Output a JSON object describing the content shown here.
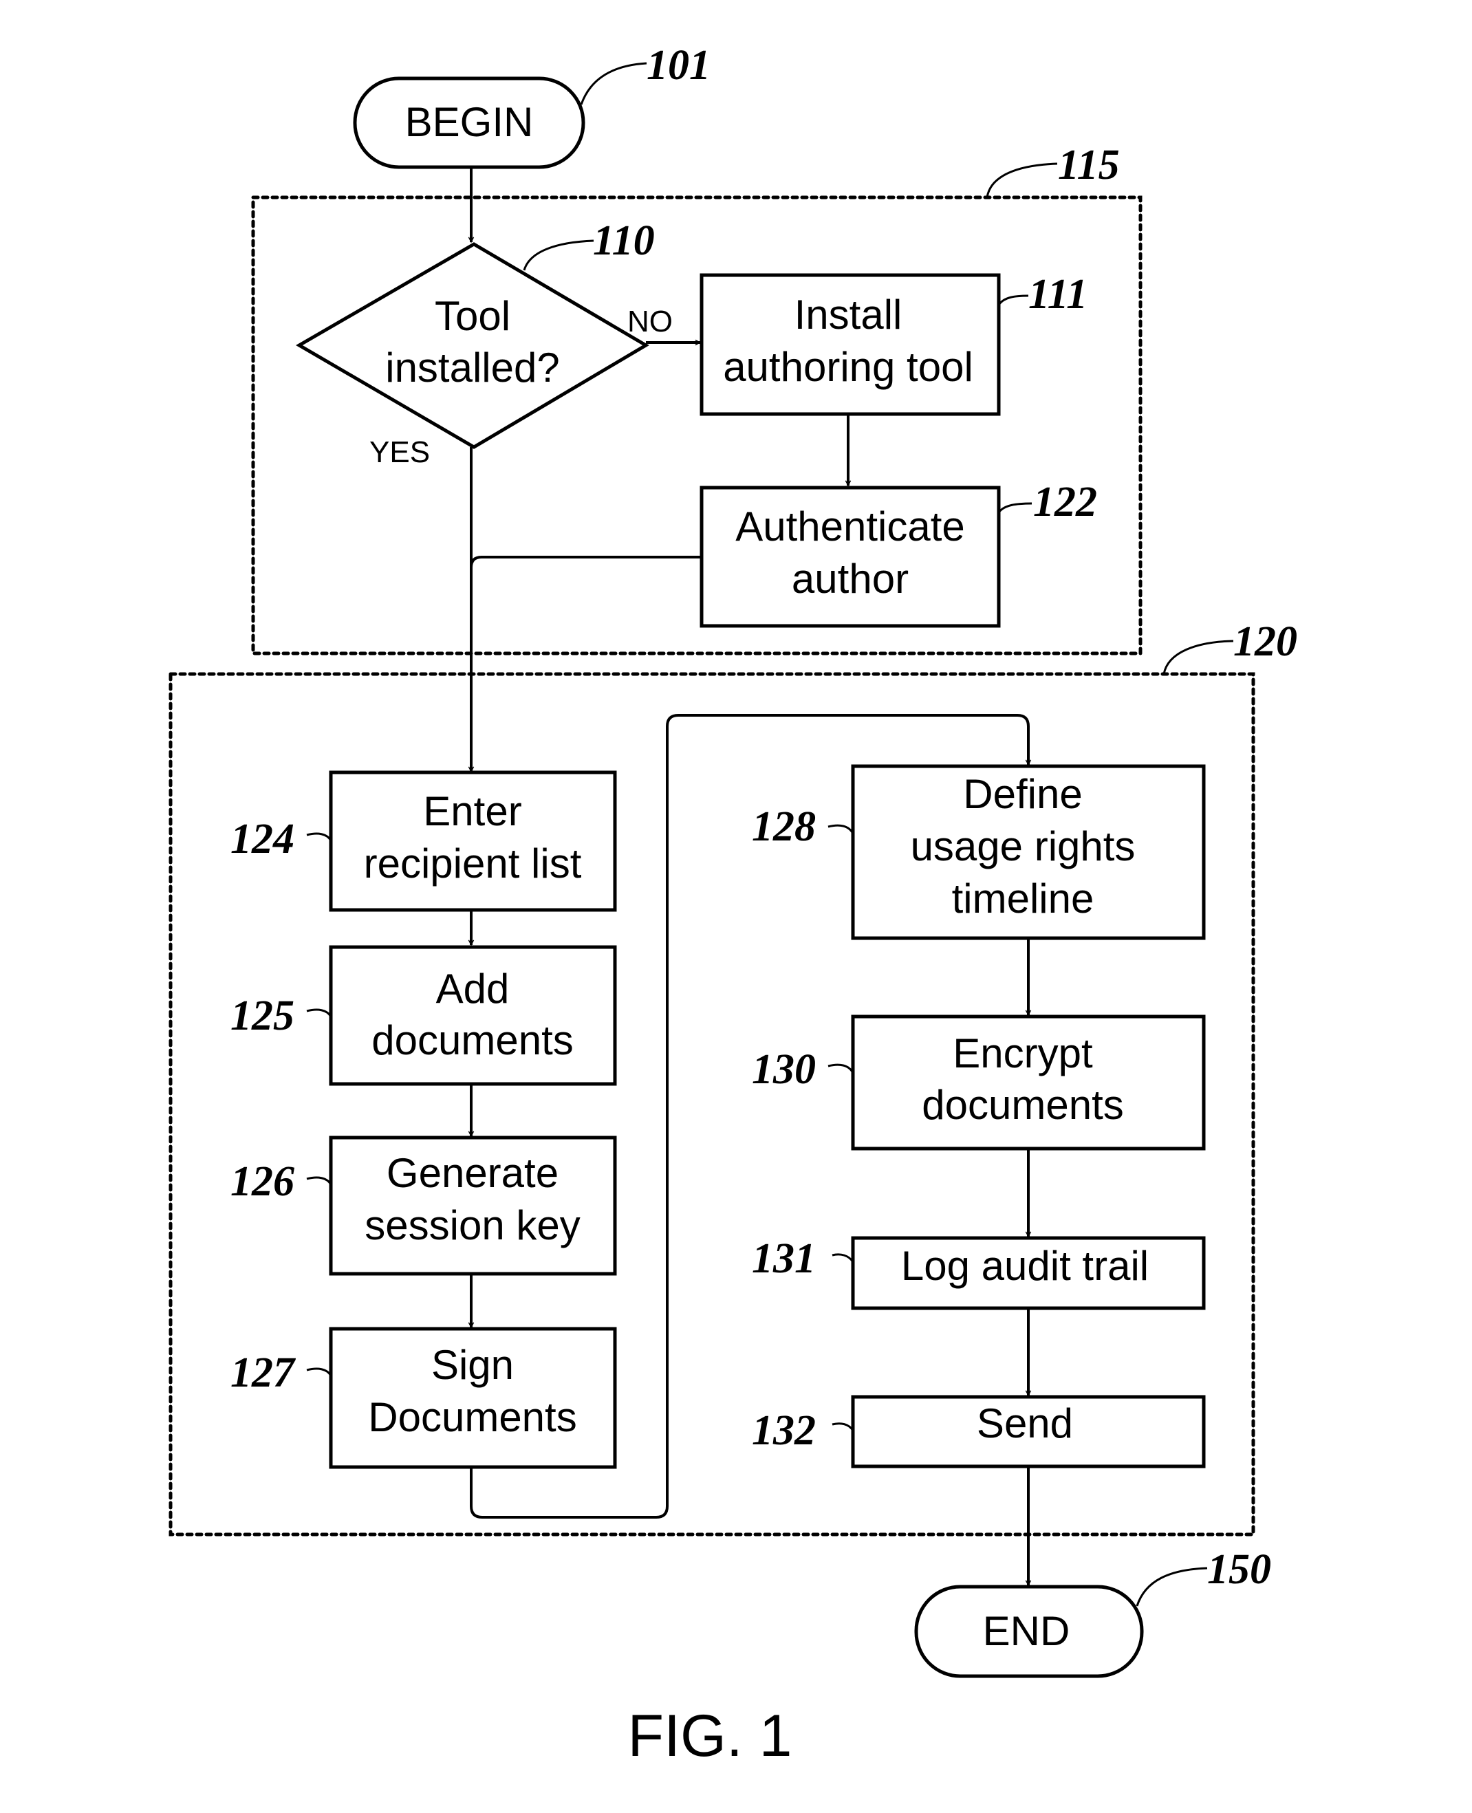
{
  "figure": {
    "caption": "FIG. 1",
    "groups": [
      {
        "id": "115",
        "ref": "115"
      },
      {
        "id": "120",
        "ref": "120"
      }
    ],
    "nodes": {
      "begin": {
        "ref": "101",
        "lines": [
          "BEGIN"
        ]
      },
      "decision": {
        "ref": "110",
        "lines": [
          "Tool",
          "installed?"
        ],
        "no_label": "NO",
        "yes_label": "YES"
      },
      "install": {
        "ref": "111",
        "lines": [
          "Install",
          "authoring tool"
        ]
      },
      "authenticate": {
        "ref": "122",
        "lines": [
          "Authenticate",
          "author"
        ]
      },
      "recipients": {
        "ref": "124",
        "lines": [
          "Enter",
          "recipient list"
        ]
      },
      "add_docs": {
        "ref": "125",
        "lines": [
          "Add",
          "documents"
        ]
      },
      "session_key": {
        "ref": "126",
        "lines": [
          "Generate",
          "session key"
        ]
      },
      "sign": {
        "ref": "127",
        "lines": [
          "Sign",
          "Documents"
        ]
      },
      "usage_rights": {
        "ref": "128",
        "lines": [
          "Define",
          "usage rights",
          "timeline"
        ]
      },
      "encrypt": {
        "ref": "130",
        "lines": [
          "Encrypt",
          "documents"
        ]
      },
      "audit": {
        "ref": "131",
        "lines": [
          "Log audit trail"
        ]
      },
      "send": {
        "ref": "132",
        "lines": [
          "Send"
        ]
      },
      "end": {
        "ref": "150",
        "lines": [
          "END"
        ]
      }
    }
  }
}
